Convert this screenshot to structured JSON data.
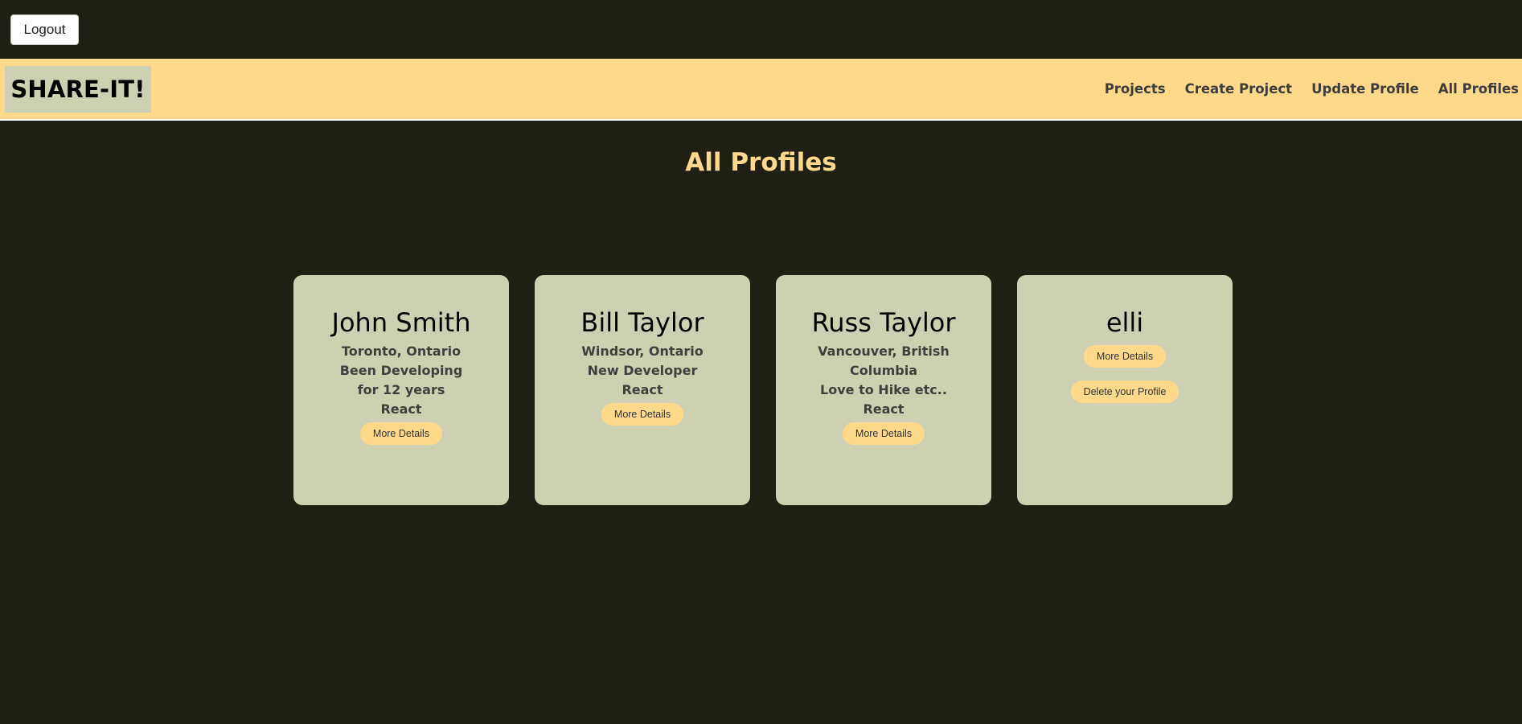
{
  "topbar": {
    "logout_label": "Logout"
  },
  "navbar": {
    "brand": "SHARE-IT!",
    "links": [
      "Projects",
      "Create Project",
      "Update Profile",
      "All Profiles"
    ]
  },
  "main": {
    "title": "All Profiles",
    "profiles": [
      {
        "name": "John Smith",
        "lines": [
          "Toronto, Ontario",
          "Been Developing for 12 years",
          "React"
        ],
        "details_label": "More Details"
      },
      {
        "name": "Bill Taylor",
        "lines": [
          "Windsor, Ontario",
          "New Developer",
          "React"
        ],
        "details_label": "More Details"
      },
      {
        "name": "Russ Taylor",
        "lines": [
          "Vancouver, British Columbia",
          "Love to Hike etc..",
          "React"
        ],
        "details_label": "More Details"
      },
      {
        "name": "elli",
        "lines": [],
        "details_label": "More Details",
        "delete_label": "Delete your Profile"
      }
    ]
  },
  "colors": {
    "background": "#1f2013",
    "accent": "#fed98b",
    "card": "#cdd1b2"
  }
}
